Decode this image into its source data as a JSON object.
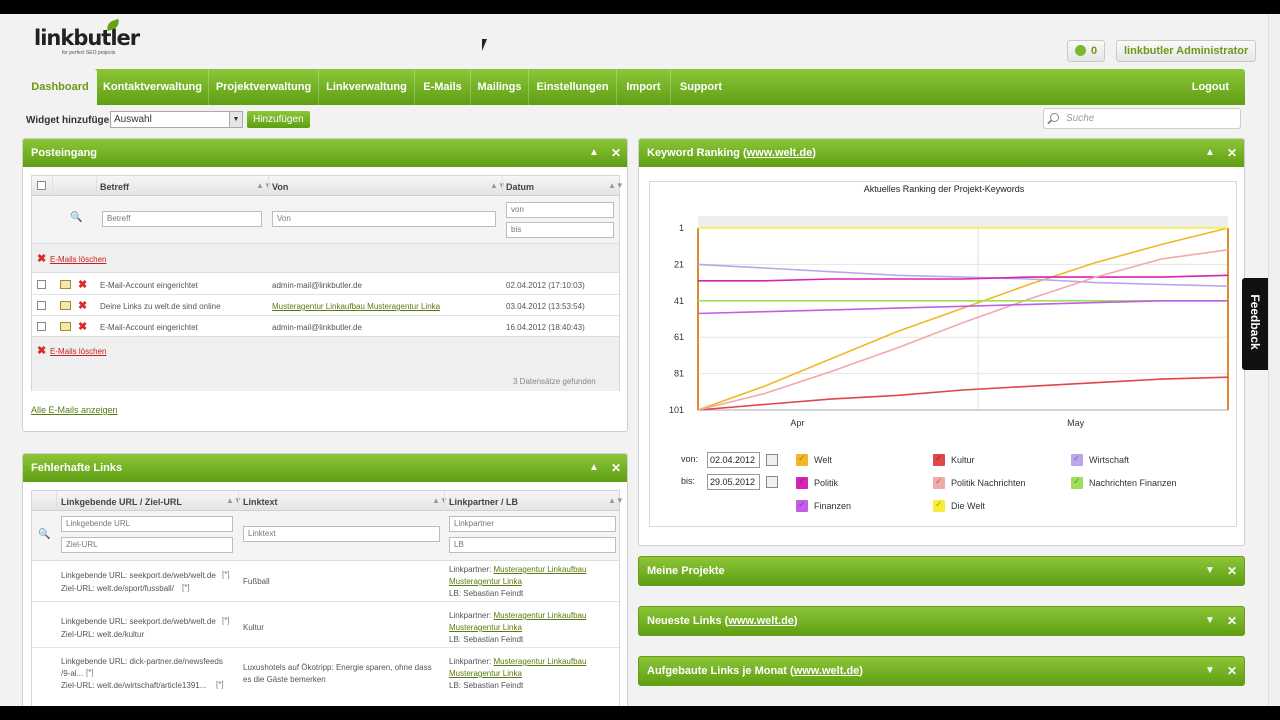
{
  "header": {
    "logo_text": "linkbutler",
    "logo_tagline": "for perfect SEO projects",
    "notifications_count": "0",
    "user_name": "linkbutler Administrator"
  },
  "nav": {
    "items": [
      {
        "label": "Dashboard"
      },
      {
        "label": "Kontaktverwaltung"
      },
      {
        "label": "Projektverwaltung"
      },
      {
        "label": "Linkverwaltung"
      },
      {
        "label": "E-Mails"
      },
      {
        "label": "Mailings"
      },
      {
        "label": "Einstellungen"
      },
      {
        "label": "Import"
      },
      {
        "label": "Support"
      }
    ],
    "logout_label": "Logout"
  },
  "toolbar": {
    "widget_label": "Widget hinzufügen",
    "widget_select_value": "Auswahl",
    "add_button_label": "Hinzufügen",
    "search_placeholder": "Suche"
  },
  "inbox": {
    "title": "Posteingang",
    "columns": [
      "Betreff",
      "Von",
      "Datum"
    ],
    "filter_betreff": "Betreff",
    "filter_von": "Von",
    "filter_von_date": "von",
    "filter_bis_date": "bis",
    "delete_label": "E-Mails löschen",
    "rows": [
      {
        "subject": "E-Mail-Account eingerichtet",
        "from": "admin-mail@linkbutler.de",
        "date": "02.04.2012 (17:10:03)"
      },
      {
        "subject": "Deine Links zu welt.de sind online",
        "from": "Musteragentur Linkaufbau Musteragentur Linka",
        "date": "03.04.2012 (13:53:54)"
      },
      {
        "subject": "E-Mail-Account eingerichtet",
        "from": "admin-mail@linkbutler.de",
        "date": "16.04.2012 (18:40:43)"
      }
    ],
    "found_text": "3 Datensätze gefunden",
    "show_all_label": "Alle E-Mails anzeigen"
  },
  "broken_links": {
    "title": "Fehlerhafte Links",
    "columns": [
      "Linkgebende URL / Ziel-URL",
      "Linktext",
      "Linkpartner / LB"
    ],
    "filter_url": "Linkgebende URL",
    "filter_ziel": "Ziel-URL",
    "filter_linktext": "Linktext",
    "filter_partner": "Linkpartner",
    "filter_lb": "LB",
    "rows": [
      {
        "url": "Linkgebende URL: seekport.de/web/welt.de",
        "ziel": "Ziel-URL: welt.de/sport/fussball/",
        "linktext": "Fußball",
        "partner_prefix": "Linkpartner: ",
        "partner_1": "Musteragentur Linkaufbau",
        "partner_2": "Musteragentur Linka",
        "lb": "LB: Sebastian Feindt"
      },
      {
        "url": "Linkgebende URL: seekport.de/web/welt.de",
        "ziel": "Ziel-URL: welt.de/kultur",
        "linktext": "Kultur",
        "partner_prefix": "Linkpartner: ",
        "partner_1": "Musteragentur Linkaufbau",
        "partner_2": "Musteragentur Linka",
        "lb": "LB: Sebastian Feindt"
      },
      {
        "url": "Linkgebende URL: dick-partner.de/newsfeeds",
        "url_2": "/9-al...",
        "ziel": "Ziel-URL: welt.de/wirtschaft/article1391...",
        "linktext": "Luxushotels auf Ökotripp: Energie sparen, ohne dass",
        "linktext_2": "es die Gäste bemerken",
        "partner_prefix": "Linkpartner: ",
        "partner_1": "Musteragentur Linkaufbau",
        "partner_2": "Musteragentur Linka",
        "lb": "LB: Sebastian Feindt"
      }
    ]
  },
  "keyword_ranking": {
    "title_prefix": "Keyword Ranking (",
    "title_link": "www.welt.de",
    "title_suffix": ")",
    "from_label": "von:",
    "to_label": "bis:",
    "from_date": "02.04.2012",
    "to_date": "29.05.2012"
  },
  "collapsed_panels": {
    "projects_title": "Meine Projekte",
    "newest_prefix": "Neueste Links (",
    "newest_link": "www.welt.de",
    "newest_suffix": ")",
    "monthly_prefix": "Aufgebaute Links je Monat (",
    "monthly_link": "www.welt.de",
    "monthly_suffix": ")"
  },
  "feedback_label": "Feedback",
  "chart_data": {
    "type": "line",
    "title": "Aktuelles Ranking der Projekt-Keywords",
    "x_tick_labels": [
      "Apr",
      "May"
    ],
    "y_tick_labels": [
      "1",
      "21",
      "41",
      "61",
      "81",
      "101"
    ],
    "ylim": [
      101,
      1
    ],
    "y_inverted": true,
    "x": [
      0,
      1,
      2,
      3,
      4,
      5,
      6,
      7,
      8
    ],
    "series": [
      {
        "name": "Welt",
        "color": "#f0b825",
        "values": [
          101,
          88,
          73,
          58,
          45,
          32,
          20,
          10,
          1
        ]
      },
      {
        "name": "Kultur",
        "color": "#e04747",
        "values": [
          101,
          98,
          95,
          93,
          90,
          88,
          86,
          84,
          83
        ]
      },
      {
        "name": "Wirtschaft",
        "color": "#b9a7e8",
        "values": [
          21,
          23,
          25,
          27,
          28,
          29,
          31,
          32,
          33
        ]
      },
      {
        "name": "Politik",
        "color": "#d622b5",
        "values": [
          30,
          30,
          29,
          29,
          29,
          28,
          28,
          28,
          27
        ]
      },
      {
        "name": "Politik Nachrichten",
        "color": "#f0aaaa",
        "values": [
          101,
          92,
          80,
          67,
          53,
          40,
          28,
          18,
          13
        ]
      },
      {
        "name": "Nachrichten Finanzen",
        "color": "#9fe05a",
        "values": [
          41,
          41,
          41,
          41,
          41,
          41,
          41,
          41,
          41
        ]
      },
      {
        "name": "Finanzen",
        "color": "#c45ce6",
        "values": [
          48,
          47,
          46,
          45,
          44,
          43,
          42,
          41,
          41
        ]
      },
      {
        "name": "Die Welt",
        "color": "#f7ee3b",
        "values": [
          1,
          1,
          1,
          1,
          1,
          1,
          1,
          1,
          1
        ]
      }
    ]
  }
}
